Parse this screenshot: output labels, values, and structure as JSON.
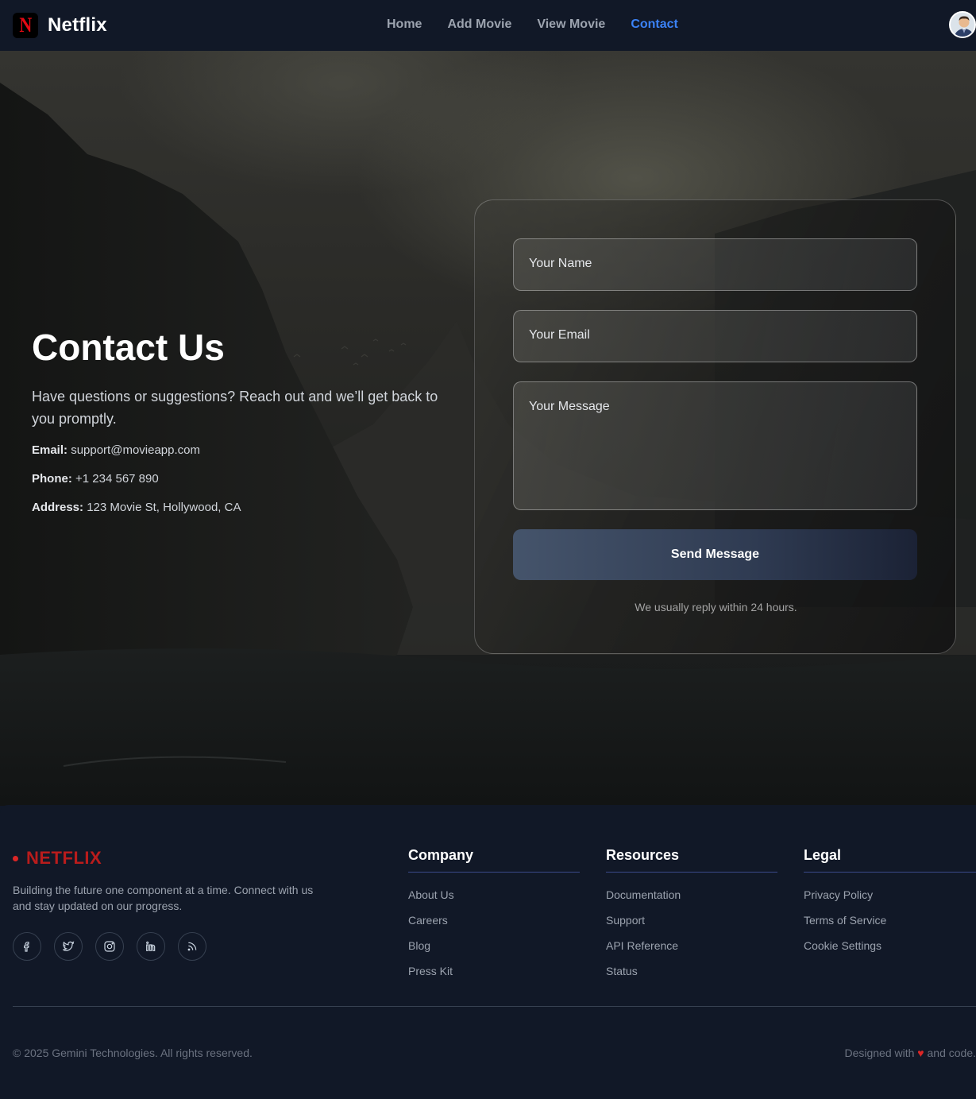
{
  "nav": {
    "brand_logo_letter": "N",
    "brand_name": "Netflix",
    "links": [
      {
        "label": "Home",
        "active": false
      },
      {
        "label": "Add Movie",
        "active": false
      },
      {
        "label": "View Movie",
        "active": false
      },
      {
        "label": "Contact",
        "active": true
      }
    ],
    "active_color": "#3b82f6"
  },
  "contact": {
    "title": "Contact Us",
    "subtitle": "Have questions or suggestions? Reach out and we’ll get back to you promptly.",
    "email_label": "Email:",
    "email_value": "support@movieapp.com",
    "phone_label": "Phone:",
    "phone_value": "+1 234 567 890",
    "address_label": "Address:",
    "address_value": "123 Movie St, Hollywood, CA"
  },
  "form": {
    "name_placeholder": "Your Name",
    "email_placeholder": "Your Email",
    "message_placeholder": "Your Message",
    "send_label": "Send Message",
    "reply_note": "We usually reply within 24 hours."
  },
  "footer": {
    "logo": "NETFLIX",
    "description": "Building the future one component at a time. Connect with us and stay updated on our progress.",
    "socials": [
      "facebook-icon",
      "twitter-icon",
      "instagram-icon",
      "linkedin-icon",
      "rss-icon"
    ],
    "columns": [
      {
        "title": "Company",
        "items": [
          "About Us",
          "Careers",
          "Blog",
          "Press Kit"
        ]
      },
      {
        "title": "Resources",
        "items": [
          "Documentation",
          "Support",
          "API Reference",
          "Status"
        ]
      },
      {
        "title": "Legal",
        "items": [
          "Privacy Policy",
          "Terms of Service",
          "Cookie Settings"
        ]
      }
    ],
    "copyright": "© 2025 Gemini Technologies. All rights reserved.",
    "designed_prefix": "Designed with",
    "designed_heart": "♥",
    "designed_suffix": "and code.",
    "brand_color": "#b91c1c"
  }
}
